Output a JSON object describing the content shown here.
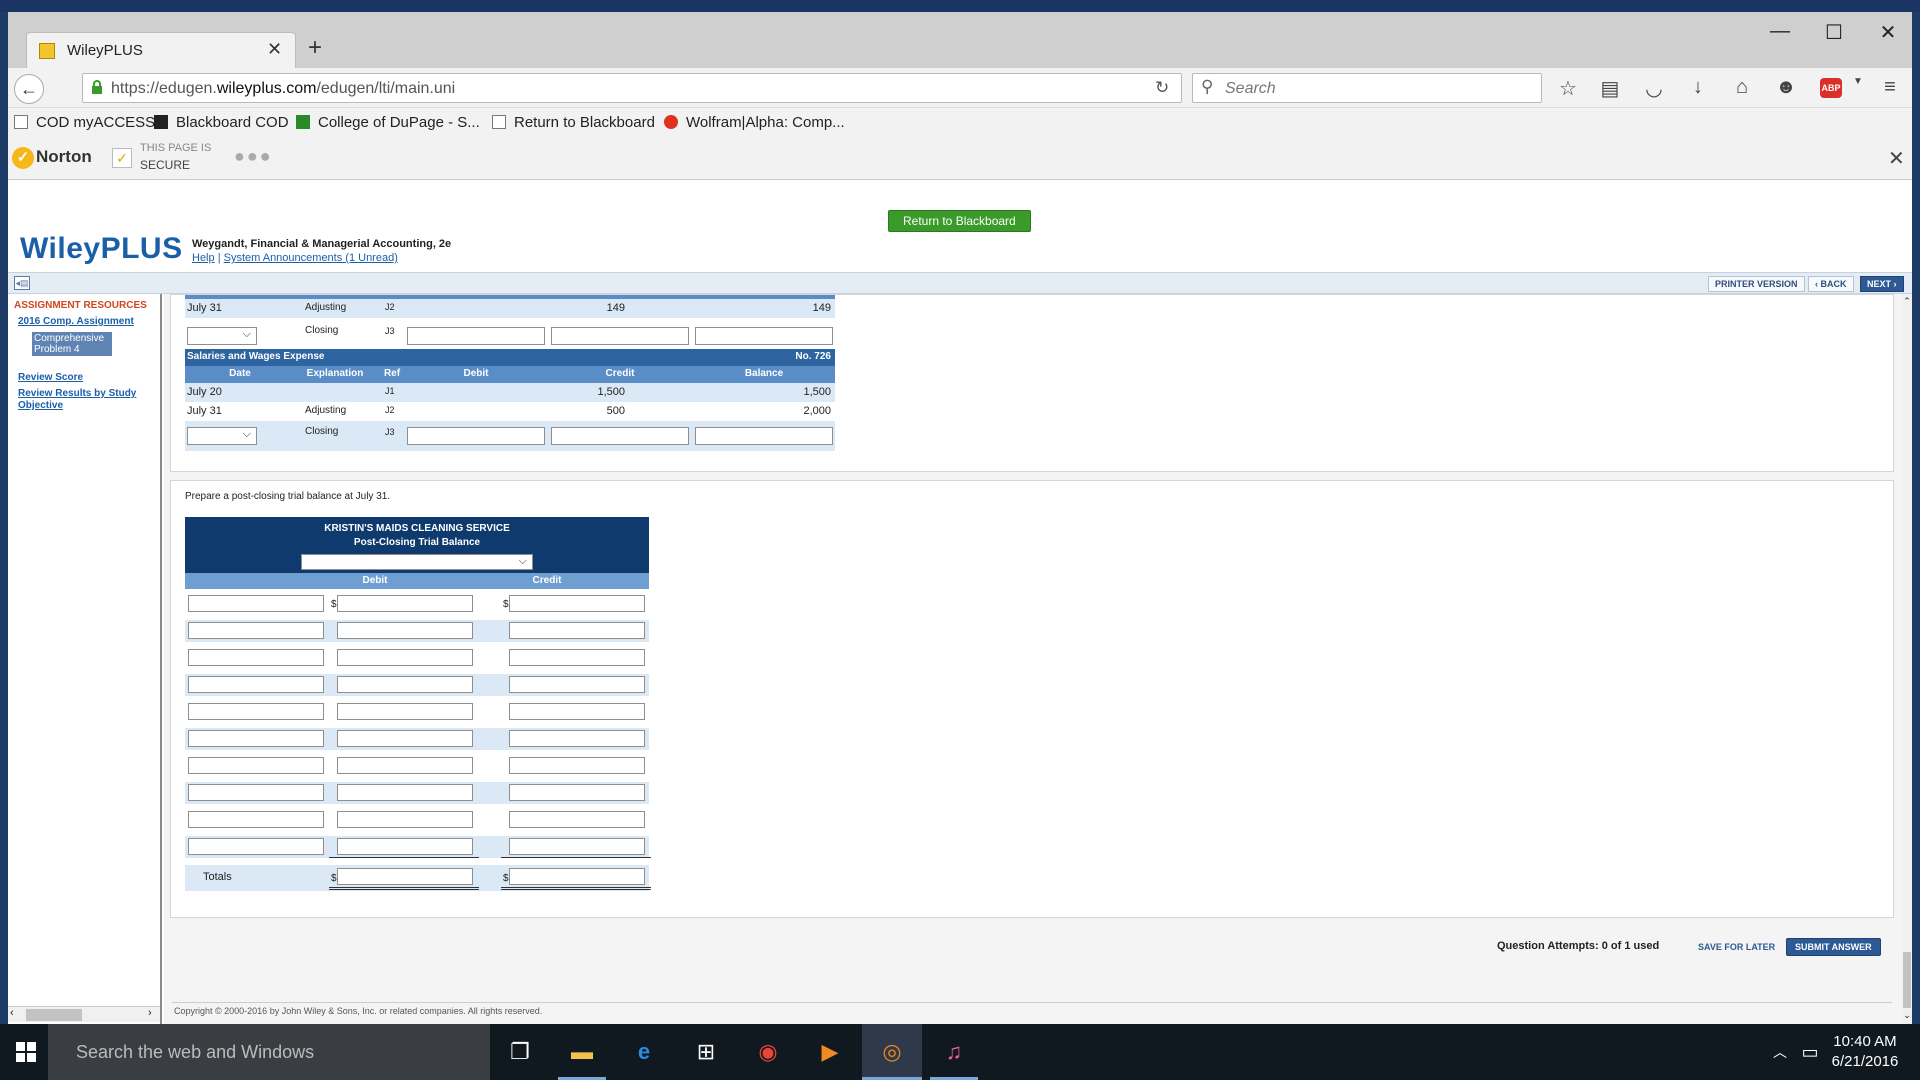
{
  "browser": {
    "tab_title": "WileyPLUS",
    "url_prefix": "https://edugen.",
    "url_domain": "wileyplus.com",
    "url_path": "/edugen/lti/main.uni",
    "search_placeholder": "Search"
  },
  "bookmarks": [
    {
      "label": "COD myACCESS"
    },
    {
      "label": "Blackboard COD"
    },
    {
      "label": "College of DuPage - S..."
    },
    {
      "label": "Return to Blackboard"
    },
    {
      "label": "Wolfram|Alpha: Comp..."
    }
  ],
  "norton": {
    "logo": "Norton",
    "line1": "THIS PAGE IS",
    "line2": "SECURE"
  },
  "wiley": {
    "return_button": "Return to Blackboard",
    "logo": "WileyPLUS",
    "course_title": "Weygandt, Financial & Managerial Accounting, 2e",
    "help": "Help",
    "separator": "|",
    "announcements": "System Announcements (1 Unread)"
  },
  "toolbar": {
    "printer": "PRINTER VERSION",
    "back": "‹ BACK",
    "next": "NEXT ›"
  },
  "sidebar": {
    "heading": "ASSIGNMENT RESOURCES",
    "assignment": "2016 Comp. Assignment",
    "selected": "Comprehensive Problem 4",
    "review_score": "Review Score",
    "review_results": "Review Results by Study Objective"
  },
  "ledger_top": {
    "row_adjusting": {
      "date": "July 31",
      "explanation": "Adjusting",
      "ref": "J2",
      "debit": "149",
      "balance": "149"
    },
    "row_closing": {
      "explanation": "Closing",
      "ref": "J3"
    }
  },
  "ledger_salaries": {
    "title": "Salaries and Wages Expense",
    "number": "No. 726",
    "headers": {
      "date": "Date",
      "explanation": "Explanation",
      "ref": "Ref",
      "debit": "Debit",
      "credit": "Credit",
      "balance": "Balance"
    },
    "rows": [
      {
        "date": "July 20",
        "explanation": "",
        "ref": "J1",
        "debit": "1,500",
        "balance": "1,500"
      },
      {
        "date": "July 31",
        "explanation": "Adjusting",
        "ref": "J2",
        "debit": "500",
        "balance": "2,000"
      }
    ],
    "closing": {
      "explanation": "Closing",
      "ref": "J3"
    }
  },
  "trial_balance": {
    "instruction": "Prepare a post-closing trial balance at July 31.",
    "company": "KRISTIN'S MAIDS CLEANING SERVICE",
    "subtitle": "Post-Closing Trial Balance",
    "col_debit": "Debit",
    "col_credit": "Credit",
    "dollar": "$",
    "totals": "Totals",
    "row_count": 10
  },
  "footer": {
    "attempts": "Question Attempts: 0 of 1 used",
    "save": "SAVE FOR LATER",
    "submit": "SUBMIT ANSWER",
    "copyright": "Copyright © 2000-2016 by John Wiley & Sons, Inc. or related companies. All rights reserved."
  },
  "taskbar": {
    "search_placeholder": "Search the web and Windows",
    "time": "10:40 AM",
    "date": "6/21/2016"
  }
}
